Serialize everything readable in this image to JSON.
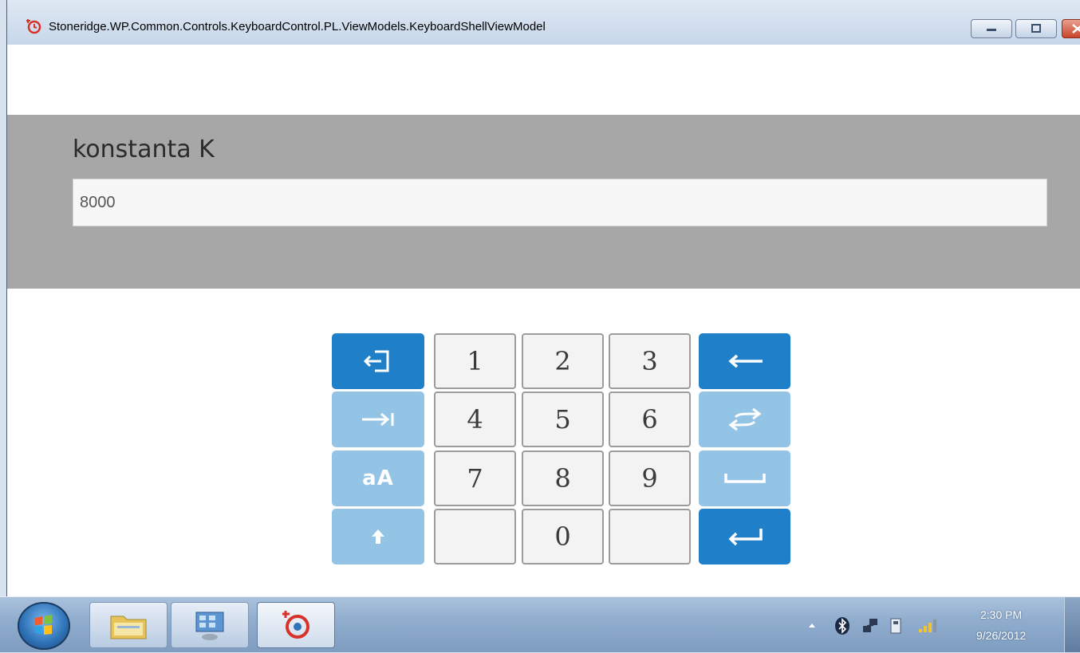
{
  "window": {
    "title": "Stoneridge.WP.Common.Controls.KeyboardControl.PL.ViewModels.KeyboardShellViewModel",
    "controls": [
      "minimize",
      "maximize",
      "close"
    ]
  },
  "form": {
    "label": "konstanta K",
    "value": "8000"
  },
  "keyboard": {
    "digits": {
      "row1": [
        "1",
        "2",
        "3"
      ],
      "row2": [
        "4",
        "5",
        "6"
      ],
      "row3": [
        "7",
        "8",
        "9"
      ],
      "row4": [
        "",
        "0",
        ""
      ]
    },
    "left_keys": [
      "exit-icon",
      "tab-icon",
      "aA",
      "shift-icon"
    ],
    "right_keys": [
      "backspace-icon",
      "swap-icon",
      "space-icon",
      "enter-icon"
    ],
    "case_label": "aA",
    "colors": {
      "active": "#1f7fc9",
      "inactive": "#93c4e6",
      "digit_bg": "#f3f3f3"
    }
  },
  "taskbar": {
    "items": [
      "start-orb",
      "file-explorer",
      "control-panel",
      "stoneridge-app"
    ],
    "tray_icons": [
      "chevron-up-icon",
      "bluetooth-icon",
      "network-icon",
      "removable-device-icon",
      "signal-icon"
    ],
    "time": "2:30 PM",
    "date": "9/26/2012"
  }
}
